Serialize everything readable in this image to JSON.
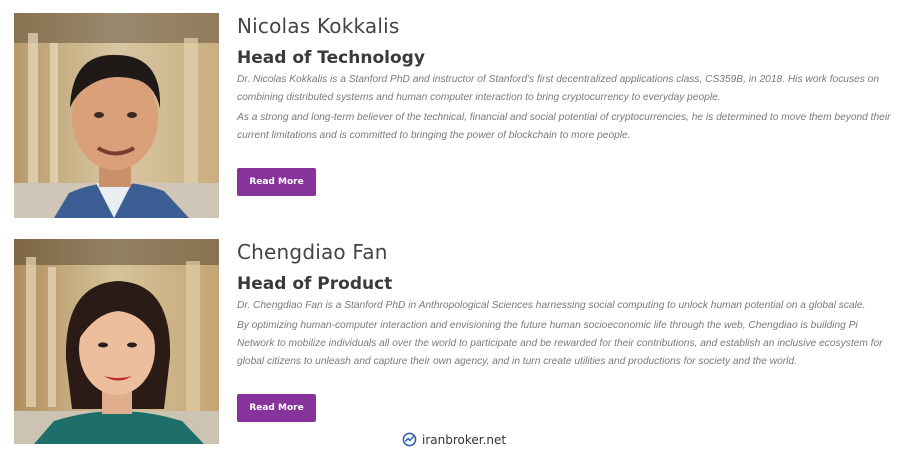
{
  "team": [
    {
      "name": "Nicolas Kokkalis",
      "role": "Head of Technology",
      "paragraphs": [
        "Dr. Nicolas Kokkalis is a Stanford PhD and instructor of Stanford's first decentralized applications class, CS359B, in 2018. His work focuses on combining distributed systems and human computer interaction to bring cryptocurrency to everyday people.",
        "As a strong and long-term believer of the technical, financial and social potential of cryptocurrencies, he is determined to move them beyond their current limitations and is committed to bringing the power of blockchain to more people."
      ],
      "button_label": "Read More"
    },
    {
      "name": "Chengdiao Fan",
      "role": "Head of Product",
      "paragraphs": [
        "Dr. Chengdiao Fan is a Stanford PhD in Anthropological Sciences harnessing social computing to unlock human potential on a global scale.",
        "By optimizing human-computer interaction and envisioning the future human socioeconomic life through the web, Chengdiao is building Pi Network to mobilize individuals all over the world to participate and be rewarded for their contributions, and establish an inclusive ecosystem for global citizens to unleash and capture their own agency, and in turn create utilities and productions for society and the world."
      ],
      "button_label": "Read More"
    }
  ],
  "watermark": {
    "text": "iranbroker.net",
    "icon": "chart-check-icon"
  },
  "colors": {
    "button": "#86349b",
    "heading": "#444444",
    "body_text": "#7a7a7a"
  }
}
